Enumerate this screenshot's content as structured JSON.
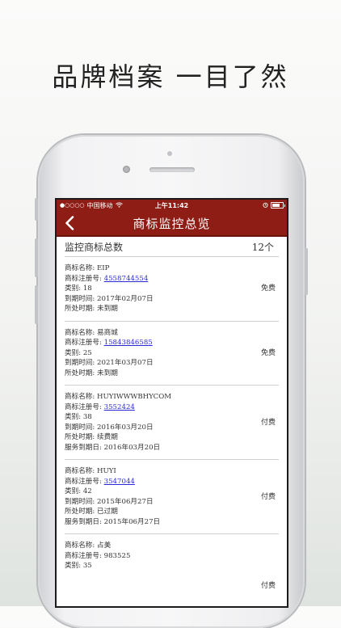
{
  "promo": {
    "headline": "品牌档案  一目了然"
  },
  "statusbar": {
    "carrier": "中国移动",
    "time": "上午11:42",
    "signal_dots": "●○○○○"
  },
  "navbar": {
    "title": "商标监控总览",
    "back_icon": "chevron-left-icon"
  },
  "summary": {
    "label": "监控商标总数",
    "count": "12个"
  },
  "trademarks": [
    {
      "name_label": "商标名称:",
      "name": "EIP",
      "reg_label": "商标注册号:",
      "reg": "4558744554",
      "class_label": "类别:",
      "class": "18",
      "expiry_label": "到期时间:",
      "expiry": "2017年02月07日",
      "period_label": "所处时期:",
      "period": "未到期",
      "fee": "免费"
    },
    {
      "name_label": "商标名称:",
      "name": "易商城",
      "reg_label": "商标注册号:",
      "reg": "15843846585",
      "class_label": "类别:",
      "class": "25",
      "expiry_label": "到期时间:",
      "expiry": "2021年03月07日",
      "period_label": "所处时期:",
      "period": "未到期",
      "fee": "免费"
    },
    {
      "name_label": "商标名称:",
      "name": "HUYIWWWBHYCOM",
      "reg_label": "商标注册号:",
      "reg": "3552424",
      "class_label": "类别:",
      "class": "38",
      "expiry_label": "到期时间:",
      "expiry": "2016年03月20日",
      "period_label": "所处时期:",
      "period": "续费期",
      "service_label": "服务到期日:",
      "service": "2016年03月20日",
      "fee": "付费"
    },
    {
      "name_label": "商标名称:",
      "name": "HUYI",
      "reg_label": "商标注册号:",
      "reg": "3547044",
      "class_label": "类别:",
      "class": "42",
      "expiry_label": "到期时间:",
      "expiry": "2015年06月27日",
      "period_label": "所处时期:",
      "period": "已过期",
      "service_label": "服务到期日:",
      "service": "2015年06月27日",
      "fee": "付费"
    },
    {
      "name_label": "商标名称:",
      "name": "占美",
      "reg_label": "商标注册号:",
      "reg": "983525",
      "class_label": "类别:",
      "class": "35",
      "fee": "付费"
    }
  ]
}
